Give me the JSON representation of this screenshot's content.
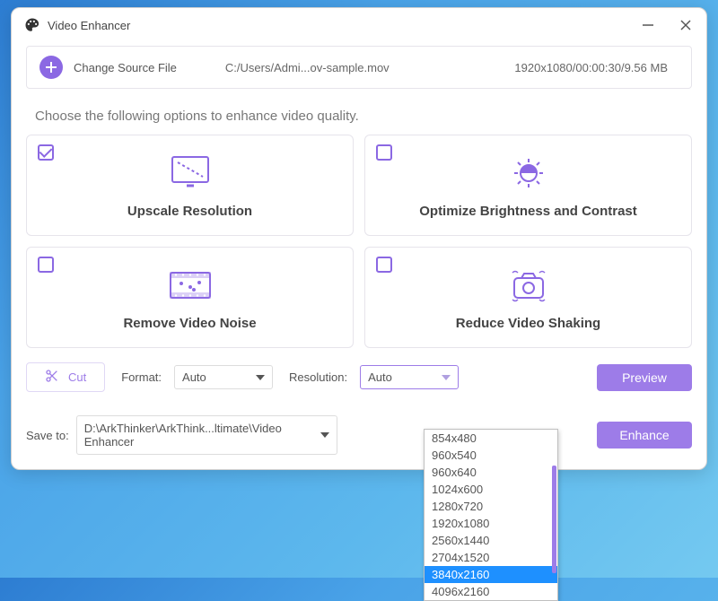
{
  "window": {
    "title": "Video Enhancer"
  },
  "source": {
    "change_label": "Change Source File",
    "path": "C:/Users/Admi...ov-sample.mov",
    "info": "1920x1080/00:00:30/9.56 MB"
  },
  "instruction": "Choose the following options to enhance video quality.",
  "options": {
    "upscale": {
      "label": "Upscale Resolution",
      "checked": true
    },
    "brightness": {
      "label": "Optimize Brightness and Contrast",
      "checked": false
    },
    "denoise": {
      "label": "Remove Video Noise",
      "checked": false
    },
    "stabilize": {
      "label": "Reduce Video Shaking",
      "checked": false
    }
  },
  "controls": {
    "cut_label": "Cut",
    "format_label": "Format:",
    "format_value": "Auto",
    "resolution_label": "Resolution:",
    "resolution_value": "Auto",
    "preview_label": "Preview",
    "enhance_label": "Enhance"
  },
  "save": {
    "label": "Save to:",
    "path": "D:\\ArkThinker\\ArkThink...ltimate\\Video Enhancer"
  },
  "resolution_dropdown": {
    "items": [
      "854x480",
      "960x540",
      "960x640",
      "1024x600",
      "1280x720",
      "1920x1080",
      "2560x1440",
      "2704x1520",
      "3840x2160",
      "4096x2160"
    ],
    "highlighted": "3840x2160"
  }
}
